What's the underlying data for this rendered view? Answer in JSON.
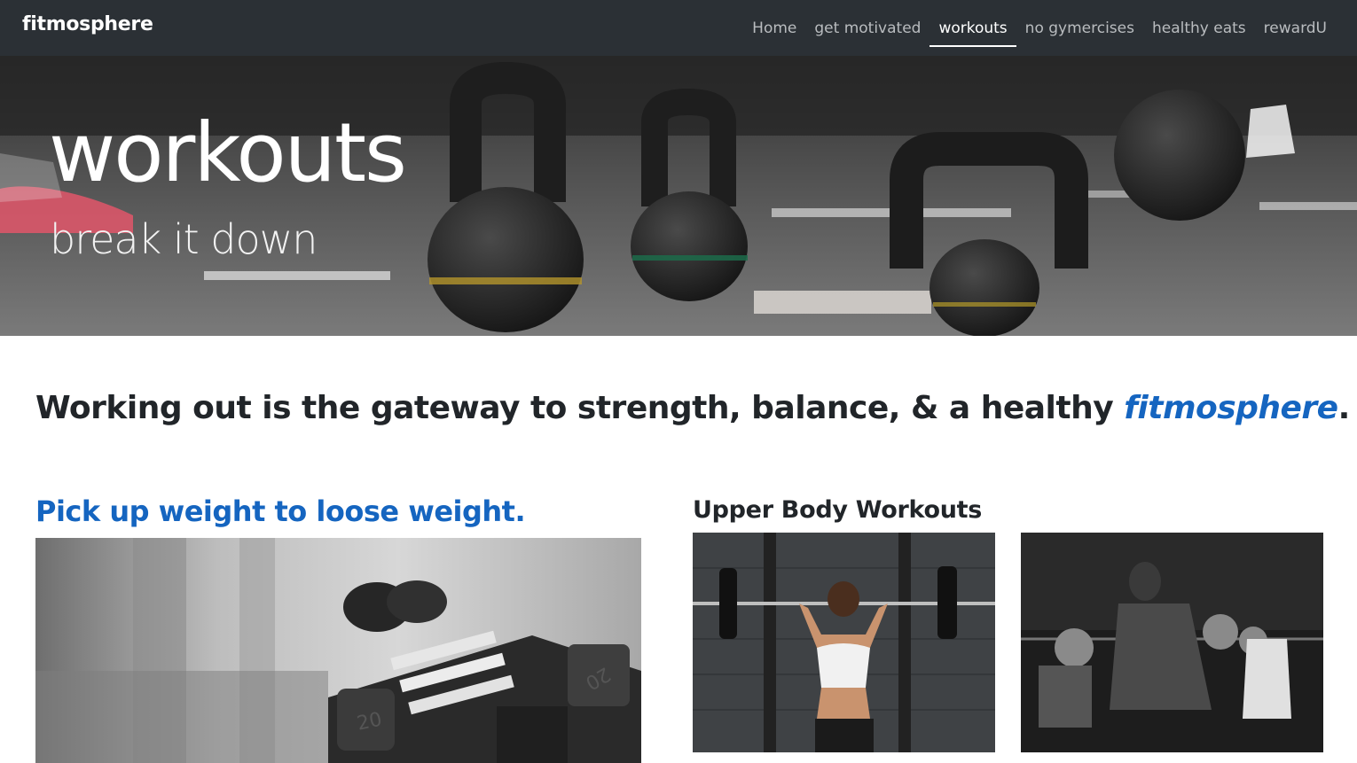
{
  "nav": {
    "brand": "fitmosphere",
    "links": [
      {
        "label": "Home",
        "active": false
      },
      {
        "label": "get motivated",
        "active": false
      },
      {
        "label": "workouts",
        "active": true
      },
      {
        "label": "no gymercises",
        "active": false
      },
      {
        "label": "healthy eats",
        "active": false
      },
      {
        "label": "rewardU",
        "active": false
      }
    ]
  },
  "hero": {
    "title": "workouts",
    "subtitle": "break it down"
  },
  "intro": {
    "text_before": "Working out is the gateway to strength, balance, & a healthy ",
    "brand_word": "fitmosphere",
    "text_after": "."
  },
  "left": {
    "heading": "Pick up weight to loose weight."
  },
  "right": {
    "heading": "Upper Body Workouts"
  },
  "colors": {
    "navbar_bg": "#2b3035",
    "accent_blue": "#1565c0",
    "text_dark": "#212529"
  }
}
